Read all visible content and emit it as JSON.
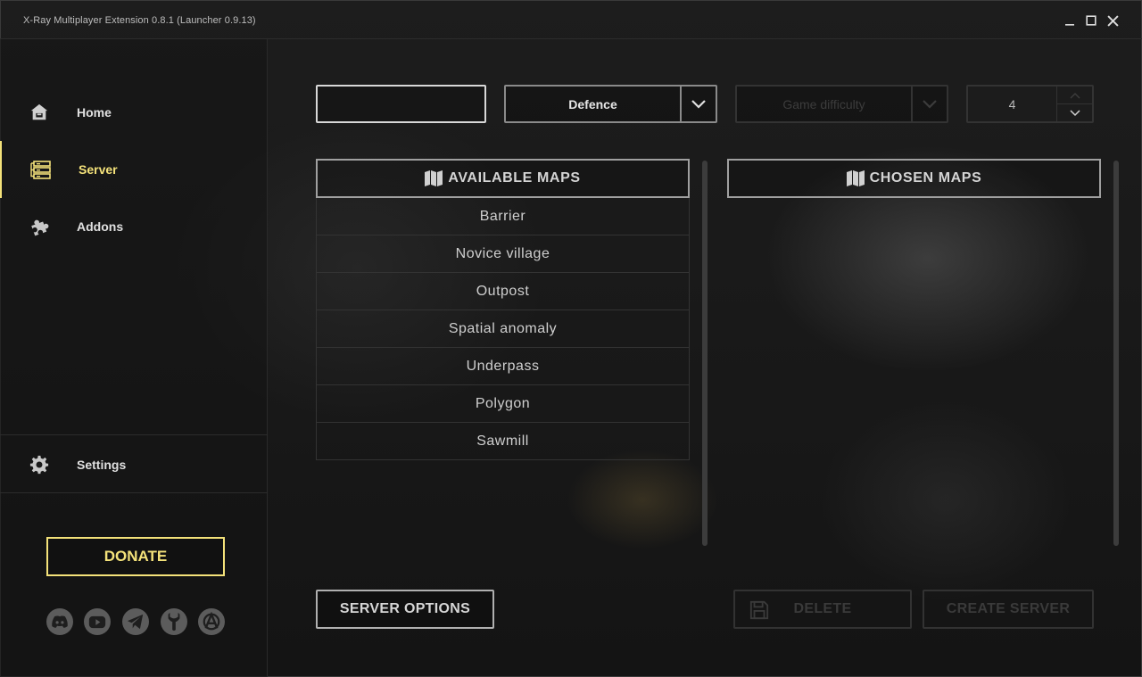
{
  "window": {
    "title": "X-Ray Multiplayer Extension 0.8.1 (Launcher 0.9.13)"
  },
  "sidebar": {
    "items": [
      {
        "label": "Home",
        "icon": "home-icon"
      },
      {
        "label": "Server",
        "icon": "server-icon",
        "active": true
      },
      {
        "label": "Addons",
        "icon": "puzzle-icon"
      }
    ],
    "settings_label": "Settings",
    "donate_label": "DONATE",
    "socials": [
      "discord-icon",
      "youtube-icon",
      "telegram-icon",
      "wrench-icon",
      "anarchy-icon"
    ]
  },
  "controls": {
    "server_name_value": "",
    "game_mode": "Defence",
    "difficulty_placeholder": "Game difficulty",
    "player_count": "4"
  },
  "maps": {
    "available_title": "AVAILABLE MAPS",
    "chosen_title": "CHOSEN MAPS",
    "available": [
      "Barrier",
      "Novice village",
      "Outpost",
      "Spatial anomaly",
      "Underpass",
      "Polygon",
      "Sawmill"
    ]
  },
  "buttons": {
    "server_options": "SERVER OPTIONS",
    "delete": "DELETE",
    "create_server": "CREATE SERVER"
  },
  "colors": {
    "accent": "#f4e27a",
    "background": "#161616",
    "disabled": "#3a3a3a"
  }
}
